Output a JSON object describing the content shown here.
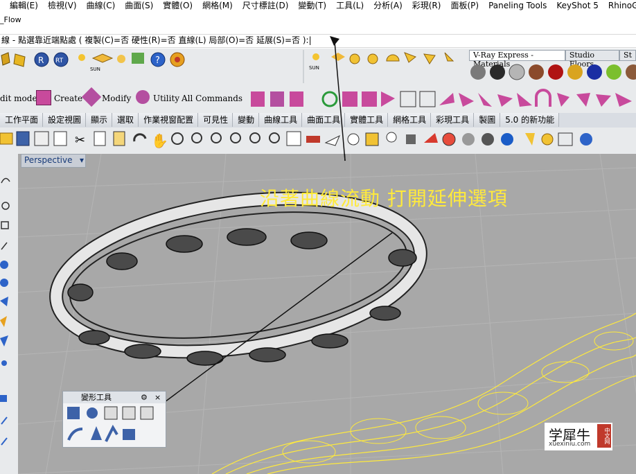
{
  "title_fragment": "_Flow",
  "menu": [
    "編輯(E)",
    "檢視(V)",
    "曲線(C)",
    "曲面(S)",
    "實體(O)",
    "網格(M)",
    "尺寸標註(D)",
    "變動(T)",
    "工具(L)",
    "分析(A)",
    "彩現(R)",
    "面板(P)",
    "Paneling Tools",
    "KeyShot 5",
    "RhinoGold"
  ],
  "command_line": "線 - 點選靠近端點處 ( 複製(C)=否  硬性(R)=否  直線(L)  局部(O)=否  延展(S)=否 ):|",
  "toolbar_labels": {
    "edit_mode": "dit mode",
    "create": "Create",
    "modify": "Modify",
    "utility": "Utility",
    "all_commands": "All Commands",
    "sun_label": "SUN",
    "sun_label_2": "SUN"
  },
  "material_tabs": [
    "V-Ray Express - Materials",
    "Studio Floors",
    "St"
  ],
  "tabs": [
    "工作平面",
    "設定視圖",
    "顯示",
    "選取",
    "作業視窗配置",
    "可見性",
    "變動",
    "曲線工具",
    "曲面工具",
    "實體工具",
    "網格工具",
    "彩現工具",
    "製圖",
    "5.0 的新功能"
  ],
  "viewport": {
    "title": "Perspective"
  },
  "annotation": "沿著曲線流動 打開延伸選項",
  "panel": {
    "title": "變形工具"
  },
  "watermark": {
    "text": "学犀牛",
    "sub": "xuexiniu.com",
    "badge": "中文网"
  },
  "colors": {
    "accent_yellow": "#ffea3c",
    "viewport_bg": "#a8a8a8",
    "tab_bg": "#d9dde3"
  }
}
